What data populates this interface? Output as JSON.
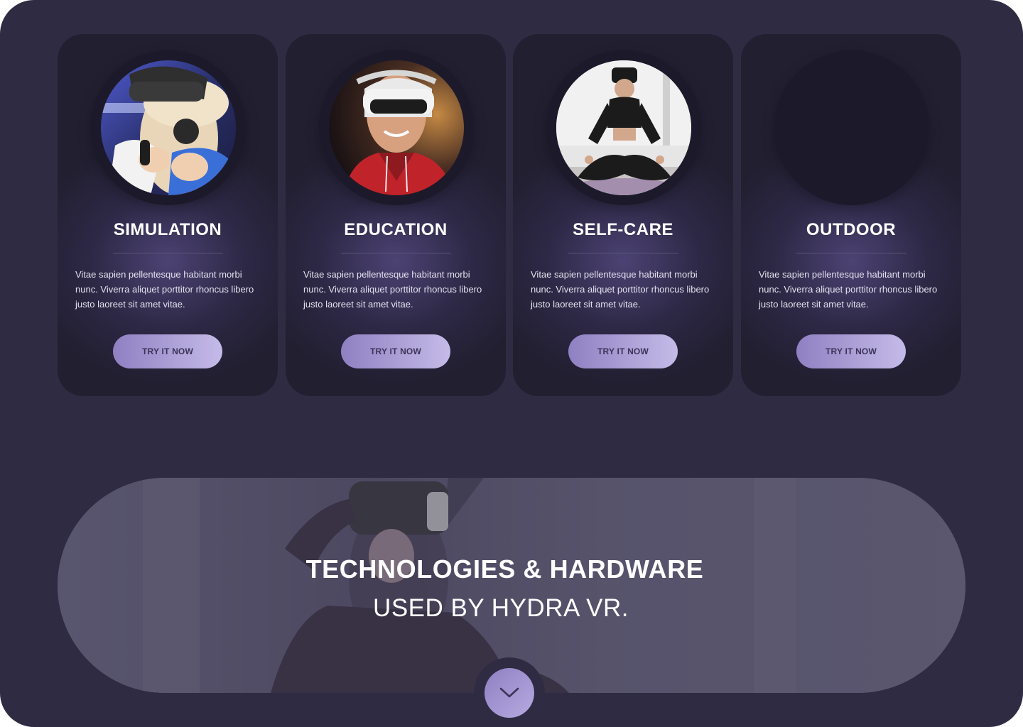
{
  "cards": [
    {
      "title": "SIMULATION",
      "text": "Vitae sapien pellentesque habitant morbi nunc. Viverra aliquet  porttitor rhoncus libero justo laoreet sit amet vitae.",
      "button": "TRY IT NOW",
      "photo": "person-with-vr-controller"
    },
    {
      "title": "EDUCATION",
      "text": "Vitae sapien pellentesque habitant morbi nunc. Viverra aliquet  porttitor rhoncus libero justo laoreet sit amet vitae.",
      "button": "TRY IT NOW",
      "photo": "smiling-man-in-vr-headset"
    },
    {
      "title": "SELF-CARE",
      "text": "Vitae sapien pellentesque habitant morbi nunc. Viverra aliquet  porttitor rhoncus libero justo laoreet sit amet vitae.",
      "button": "TRY IT NOW",
      "photo": "woman-meditating-in-vr"
    },
    {
      "title": "OUTDOOR",
      "text": "Vitae sapien pellentesque habitant morbi nunc. Viverra aliquet  porttitor rhoncus libero justo laoreet sit amet vitae.",
      "button": "TRY IT NOW",
      "photo": "empty-placeholder"
    }
  ],
  "banner": {
    "heading": "TECHNOLOGIES & HARDWARE",
    "subheading": "USED BY HYDRA VR.",
    "photo": "woman-wearing-vr-headset"
  },
  "scroll_button": {
    "icon": "chevron-down-icon"
  },
  "colors": {
    "page_background": "#2f2b43",
    "card_background": "#221f31",
    "button_gradient_start": "#8f80c2",
    "button_gradient_end": "#c5bbe8",
    "button_text": "#3b3458",
    "text_primary": "#ffffff"
  }
}
